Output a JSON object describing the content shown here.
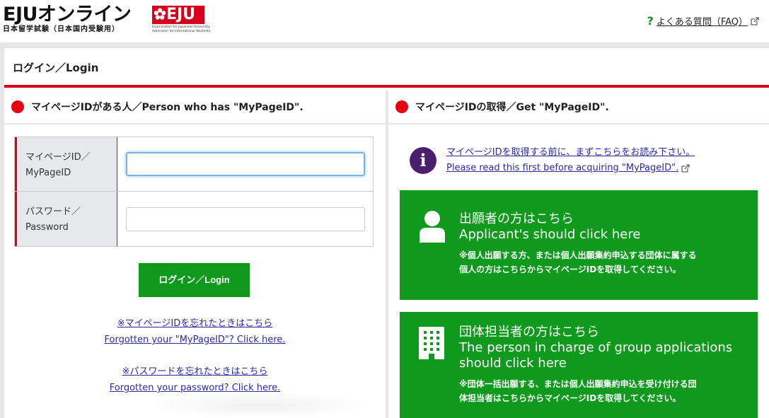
{
  "header": {
    "logo_main": "EJUオンライン",
    "logo_sub": "日本留学試験（日本国内受験用）",
    "badge": "EJU",
    "badge_caption": "Examination for Japanese University Admission for International Students",
    "faq_label": "よくある質問（FAQ）"
  },
  "panel": {
    "title": "ログイン／Login"
  },
  "login_section": {
    "heading": "マイページIDがある人／Person who has \"MyPageID\".",
    "mypageid_label_line1": "マイページID／",
    "mypageid_label_line2": "MyPageID",
    "mypageid_value": "",
    "password_label_line1": "パスワード／",
    "password_label_line2": "Password",
    "password_value": "",
    "login_button": "ログイン／Login",
    "forgot_id_jp": "※マイページIDを忘れたときはこちら",
    "forgot_id_en": "Forgotten your \"MyPageID\"? Click here.",
    "forgot_pw_jp": "※パスワードを忘れたときはこちら",
    "forgot_pw_en": "Forgotten your password? Click here."
  },
  "get_section": {
    "heading": "マイページIDの取得／Get \"MyPageID\".",
    "info_jp": "マイページIDを取得する前に、まずこちらをお読み下さい。",
    "info_en": "Please read this first before acquiring \"MyPageID\".",
    "applicant_title_jp": "出願者の方はこちら",
    "applicant_title_en": "Applicant's should click here",
    "applicant_note_line1": "※個人出願する方、または個人出願集約申込する団体に属する",
    "applicant_note_line2": "個人の方はこちらからマイページIDを取得してください。",
    "group_title_jp": "団体担当者の方はこちら",
    "group_title_en_line1": "The person in charge of group applications",
    "group_title_en_line2": "should click here",
    "group_note_line1": "※団体一括出願する、または個人出願集約申込を受け付ける団",
    "group_note_line2": "体担当者はこちらからマイページIDを取得してください。"
  },
  "colors": {
    "accent_red": "#d9001b",
    "button_green": "#0f9a1d",
    "link_blue": "#2a2aa8",
    "info_purple": "#4a1f6e"
  }
}
